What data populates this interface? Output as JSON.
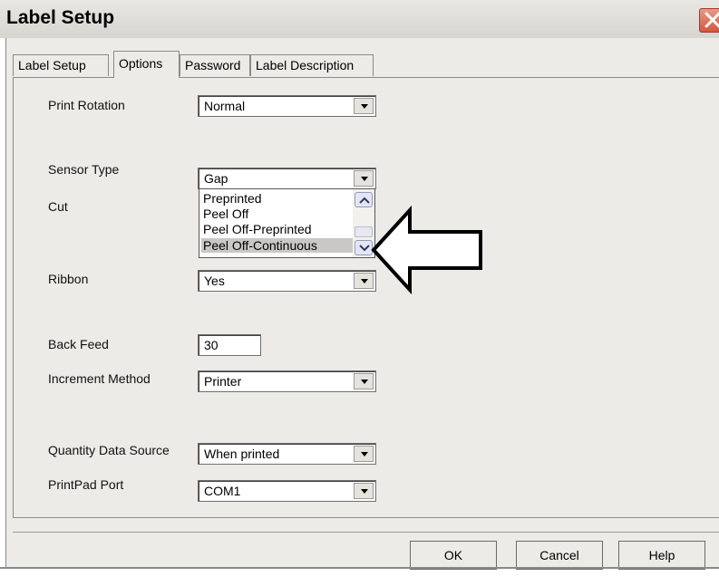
{
  "window": {
    "title": "Label Setup",
    "close_icon": "close-x-icon"
  },
  "tabs": [
    {
      "label": "Label Setup",
      "active": false
    },
    {
      "label": "Options",
      "active": true
    },
    {
      "label": "Password",
      "active": false
    },
    {
      "label": "Label Description",
      "active": false
    }
  ],
  "fields": {
    "print_rotation": {
      "label": "Print Rotation",
      "value": "Normal"
    },
    "sensor_type": {
      "label": "Sensor Type",
      "value": "Gap"
    },
    "cut": {
      "label": "Cut"
    },
    "ribbon": {
      "label": "Ribbon",
      "value": "Yes"
    },
    "back_feed": {
      "label": "Back Feed",
      "value": "30"
    },
    "increment_method": {
      "label": "Increment Method",
      "value": "Printer"
    },
    "quantity_data_source": {
      "label": "Quantity Data Source",
      "value": "When printed"
    },
    "printpad_port": {
      "label": "PrintPad Port",
      "value": "COM1"
    }
  },
  "dropdown_list": {
    "items": [
      "Preprinted",
      "Peel Off",
      "Peel Off-Preprinted",
      "Peel Off-Continuous"
    ],
    "selected": "Peel Off-Continuous"
  },
  "buttons": {
    "ok": "OK",
    "cancel": "Cancel",
    "help": "Help"
  },
  "annotation": {
    "icon": "left-arrow-icon",
    "color": "#000000"
  }
}
